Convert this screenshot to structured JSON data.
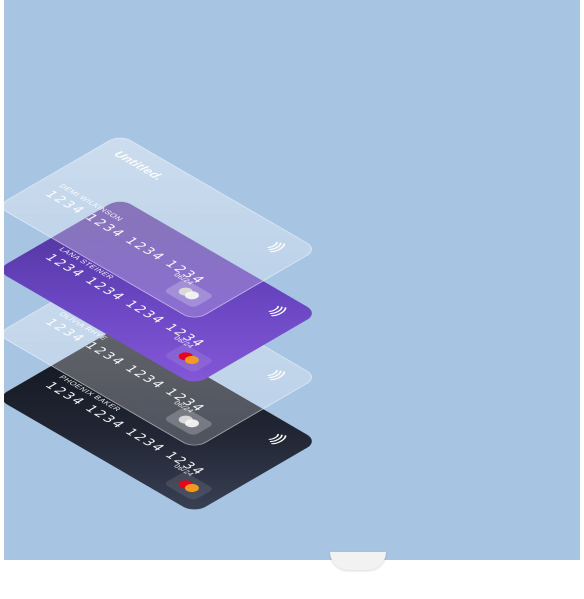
{
  "image": {
    "background_color": "#a7c4e2"
  },
  "cards": [
    {
      "style": "dark",
      "holder": "PHOENIX BAKER",
      "number": "1234 1234 1234 1234",
      "expiry": "06/24",
      "brand": "",
      "network_icon": "mastercard-icon",
      "contactless_icon": "contactless-icon",
      "network_colors": [
        "#eb001b",
        "#f79e1b"
      ]
    },
    {
      "style": "glass",
      "holder": "OLIVIA RHYE",
      "number": "1234 1234 1234 1234",
      "expiry": "06/24",
      "brand": "",
      "network_icon": "mastercard-icon",
      "contactless_icon": "contactless-icon",
      "network_colors": [
        "#d9d9d9",
        "#f4f4f4"
      ]
    },
    {
      "style": "purple",
      "holder": "LANA STEINER",
      "number": "1234 1234 1234 1234",
      "expiry": "06/24",
      "brand": "",
      "network_icon": "mastercard-icon",
      "contactless_icon": "contactless-icon",
      "network_colors": [
        "#eb001b",
        "#f79e1b"
      ]
    },
    {
      "style": "glass",
      "holder": "DEMI WILKINSON",
      "number": "1234 1234 1234 1234",
      "expiry": "06/24",
      "brand": "Untitled.",
      "network_icon": "mastercard-icon",
      "contactless_icon": "contactless-icon",
      "network_colors": [
        "#d9d9d9",
        "#f4f4f4"
      ]
    }
  ]
}
